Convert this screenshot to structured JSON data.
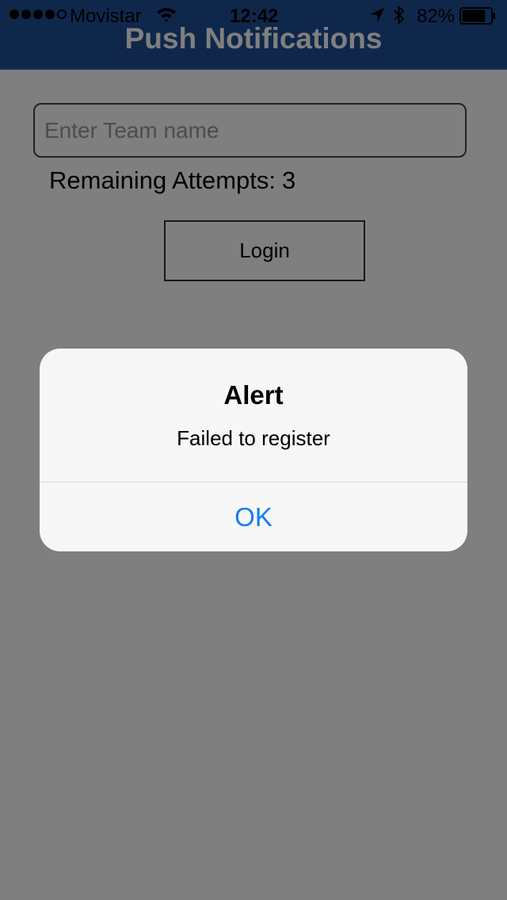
{
  "status_bar": {
    "carrier": "Movistar",
    "time": "12:42",
    "battery": "82%",
    "battery_level": 0.82,
    "signal_bars_filled": 4,
    "signal_bars_total": 5
  },
  "header": {
    "title": "Push Notifications"
  },
  "form": {
    "team_placeholder": "Enter Team name",
    "team_value": "",
    "remaining_label": "Remaining Attempts:",
    "remaining_count": "3",
    "login_label": "Login"
  },
  "alert": {
    "title": "Alert",
    "message": "Failed to register",
    "ok_label": "OK"
  },
  "colors": {
    "header_bg": "#1f4f97",
    "alert_button": "#137cf7"
  }
}
